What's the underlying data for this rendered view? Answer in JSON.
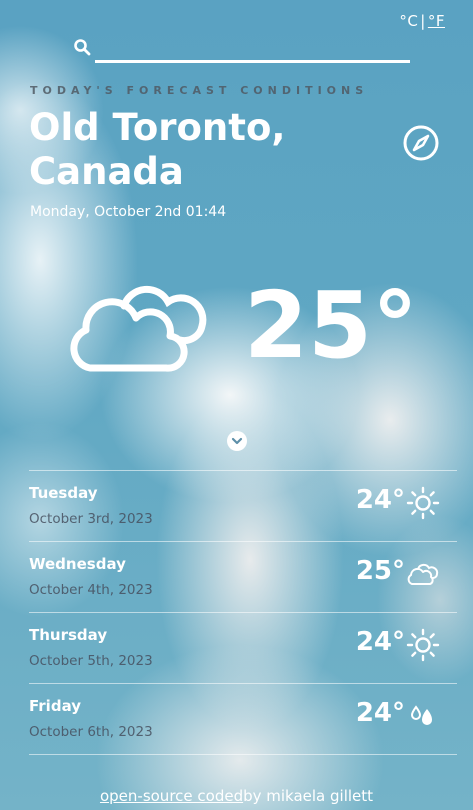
{
  "units": {
    "celsius": "°C",
    "separator": "|",
    "fahrenheit": "°F"
  },
  "search": {
    "value": "",
    "placeholder": ""
  },
  "header": {
    "kicker": "TODAY'S FORECAST CONDITIONS",
    "city": "Old Toronto, Canada",
    "datetime": "Monday, October 2nd 01:44"
  },
  "current": {
    "temperature": "25°",
    "icon": "cloud-icon"
  },
  "forecast": [
    {
      "day": "Tuesday",
      "date": "October 3rd, 2023",
      "temp": "24°",
      "icon": "sun-icon"
    },
    {
      "day": "Wednesday",
      "date": "October 4th, 2023",
      "temp": "25°",
      "icon": "cloud-icon"
    },
    {
      "day": "Thursday",
      "date": "October 5th, 2023",
      "temp": "24°",
      "icon": "sun-icon"
    },
    {
      "day": "Friday",
      "date": "October 6th, 2023",
      "temp": "24°",
      "icon": "drops-icon"
    }
  ],
  "footer": {
    "link_text": "open-source coded",
    "author_text": "by mikaela gillett"
  }
}
